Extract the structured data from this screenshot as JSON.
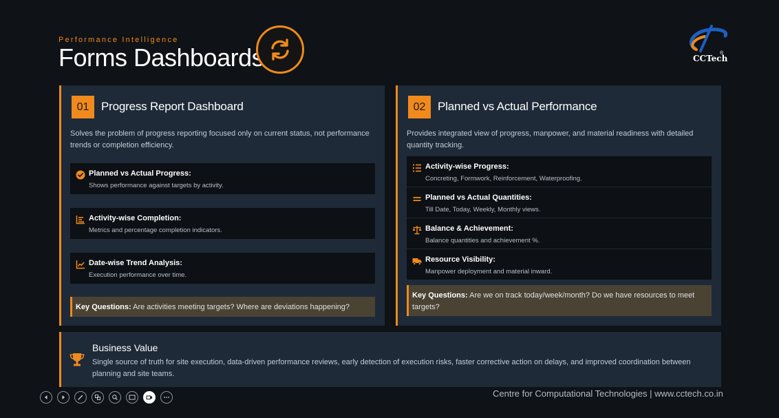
{
  "header": {
    "eyebrow": "Performance Intelligence",
    "title": "Forms Dashboards",
    "logo_text": "CCTech",
    "logo_reg": "®"
  },
  "colors": {
    "accent": "#f08a1c",
    "card": "#1e2a38",
    "background": "#0f1216",
    "key_box": "#4a4233"
  },
  "cards": [
    {
      "number": "01",
      "title": "Progress Report Dashboard",
      "description": "Solves the problem of progress reporting focused only on current status, not performance trends or completion efficiency.",
      "features": [
        {
          "icon": "check-circle-icon",
          "title": "Planned vs Actual Progress:",
          "desc": "Shows performance against targets by activity."
        },
        {
          "icon": "list-bars-icon",
          "title": "Activity-wise Completion:",
          "desc": "Metrics and percentage completion indicators."
        },
        {
          "icon": "trend-line-icon",
          "title": "Date-wise Trend Analysis:",
          "desc": "Execution performance over time."
        }
      ],
      "key_label": "Key Questions:",
      "key_text": " Are activities meeting targets? Where are deviations happening?"
    },
    {
      "number": "02",
      "title": "Planned vs Actual Performance",
      "description": "Provides integrated view of progress, manpower, and material readiness with detailed quantity tracking.",
      "features": [
        {
          "icon": "numbered-list-icon",
          "title": "Activity-wise Progress:",
          "desc": "Concreting, Formwork, Reinforcement, Waterproofing."
        },
        {
          "icon": "equals-icon",
          "title": "Planned vs Actual Quantities:",
          "desc": "Till Date, Today, Weekly, Monthly views."
        },
        {
          "icon": "balance-scale-icon",
          "title": "Balance & Achievement:",
          "desc": "Balance quantities and achievement %."
        },
        {
          "icon": "truck-icon",
          "title": "Resource Visibility:",
          "desc": "Manpower deployment and material inward."
        }
      ],
      "key_label": "Key Questions:",
      "key_text": " Are we on track today/week/month? Do we have resources to meet targets?"
    }
  ],
  "business_value": {
    "icon": "trophy-icon",
    "title": "Business Value",
    "text": "Single source of truth for site execution, data-driven performance reviews, early detection of execution risks, faster corrective action on delays, and improved coordination between planning and site teams."
  },
  "footer": {
    "text": "Centre for Computational Technologies | www.cctech.co.in"
  },
  "controls": [
    "previous-icon",
    "next-icon",
    "pen-icon",
    "slides-icon",
    "zoom-icon",
    "subtitles-icon",
    "camera-icon",
    "more-icon"
  ]
}
